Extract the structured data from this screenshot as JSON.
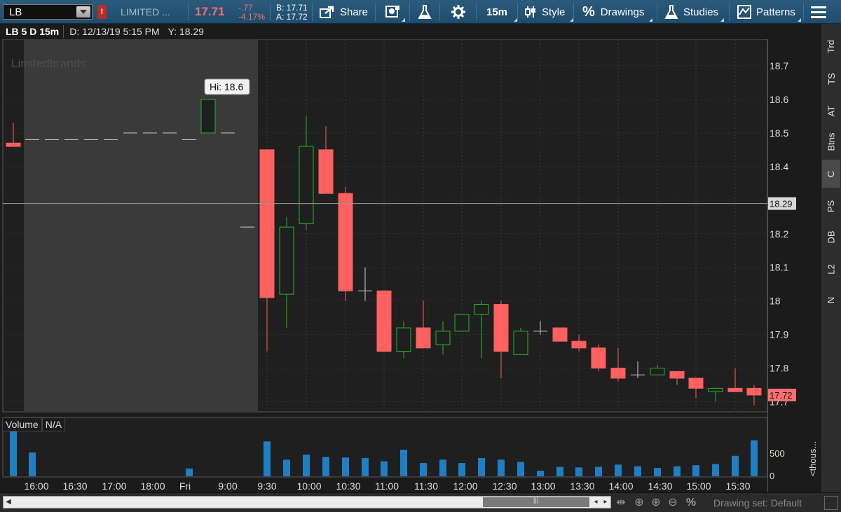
{
  "toolbar": {
    "symbol": "LB",
    "alert_badge": "!",
    "company": "LIMITED ...",
    "last_price": "17.71",
    "net_change": "-.77",
    "pct_change": "-4.17%",
    "bid": "B: 17.71",
    "ask": "A: 17.72",
    "share_label": "Share",
    "aggregation": "15m",
    "style_label": "Style",
    "drawings_label": "Drawings",
    "studies_label": "Studies",
    "patterns_label": "Patterns",
    "accent_down": "#ff6f6f",
    "bg": "#285878"
  },
  "chart_header": {
    "symbol_period": "LB 5 D 15m",
    "date": "D: 12/13/19 5:15 PM",
    "y_readout": "Y: 18.29"
  },
  "chart": {
    "watermark": "Limitedbrands",
    "hi_label": "Hi: 18.6",
    "crosshair_price": "18.29",
    "last_price_tag": "17.72",
    "y_ticks": [
      "18.7",
      "18.6",
      "18.5",
      "18.4",
      "18.3",
      "18.2",
      "18.1",
      "18",
      "17.9",
      "17.8",
      "17.7"
    ],
    "x_ticks": [
      "16:00",
      "16:30",
      "17:00",
      "18:00",
      "Fri",
      "9:00",
      "9:30",
      "10:00",
      "10:30",
      "11:00",
      "11:30",
      "12:00",
      "12:30",
      "13:00",
      "13:30",
      "14:00",
      "14:30",
      "15:00",
      "15:30"
    ]
  },
  "volume": {
    "label": "Volume",
    "value": "N/A",
    "tick_500": "500",
    "tick_0": "0",
    "unit_label": "<thous..."
  },
  "side_tabs": [
    "Trd",
    "TS",
    "AT",
    "Btns",
    "C",
    "PS",
    "DB",
    "L2",
    "N"
  ],
  "bottom": {
    "drawing_set": "Drawing set: Default"
  },
  "chart_data": {
    "type": "candlestick",
    "symbol": "LB",
    "interval": "15m",
    "ylim": [
      17.67,
      18.76
    ],
    "candles": [
      {
        "t": "15:45",
        "o": 18.47,
        "h": 18.53,
        "l": 18.46,
        "c": 18.46
      },
      {
        "t": "16:00",
        "o": 18.48,
        "h": 18.48,
        "l": 18.48,
        "c": 18.48
      },
      {
        "t": "16:15",
        "o": 18.48,
        "h": 18.48,
        "l": 18.48,
        "c": 18.48
      },
      {
        "t": "16:30",
        "o": 18.48,
        "h": 18.48,
        "l": 18.48,
        "c": 18.48
      },
      {
        "t": "16:45",
        "o": 18.48,
        "h": 18.48,
        "l": 18.48,
        "c": 18.48
      },
      {
        "t": "17:00",
        "o": 18.48,
        "h": 18.48,
        "l": 18.48,
        "c": 18.48
      },
      {
        "t": "17:30",
        "o": 18.5,
        "h": 18.5,
        "l": 18.5,
        "c": 18.5
      },
      {
        "t": "17:45",
        "o": 18.5,
        "h": 18.5,
        "l": 18.5,
        "c": 18.5
      },
      {
        "t": "18:00",
        "o": 18.5,
        "h": 18.5,
        "l": 18.5,
        "c": 18.5
      },
      {
        "t": "18:15",
        "o": 18.48,
        "h": 18.48,
        "l": 18.48,
        "c": 18.48
      },
      {
        "t": "8:30",
        "o": 18.5,
        "h": 18.6,
        "l": 18.5,
        "c": 18.6
      },
      {
        "t": "8:45",
        "o": 18.5,
        "h": 18.5,
        "l": 18.5,
        "c": 18.5
      },
      {
        "t": "9:15",
        "o": 18.22,
        "h": 18.22,
        "l": 18.22,
        "c": 18.22
      },
      {
        "t": "9:30",
        "o": 18.45,
        "h": 18.45,
        "l": 17.85,
        "c": 18.01
      },
      {
        "t": "9:45",
        "o": 18.02,
        "h": 18.25,
        "l": 17.92,
        "c": 18.22
      },
      {
        "t": "10:00",
        "o": 18.23,
        "h": 18.55,
        "l": 18.21,
        "c": 18.46
      },
      {
        "t": "10:15",
        "o": 18.45,
        "h": 18.52,
        "l": 18.32,
        "c": 18.32
      },
      {
        "t": "10:30",
        "o": 18.32,
        "h": 18.34,
        "l": 18.0,
        "c": 18.03
      },
      {
        "t": "10:45",
        "o": 18.03,
        "h": 18.1,
        "l": 18.0,
        "c": 18.03
      },
      {
        "t": "11:00",
        "o": 18.03,
        "h": 18.03,
        "l": 17.85,
        "c": 17.85
      },
      {
        "t": "11:15",
        "o": 17.85,
        "h": 17.94,
        "l": 17.83,
        "c": 17.92
      },
      {
        "t": "11:30",
        "o": 17.92,
        "h": 18.0,
        "l": 17.86,
        "c": 17.86
      },
      {
        "t": "11:45",
        "o": 17.87,
        "h": 17.94,
        "l": 17.84,
        "c": 17.91
      },
      {
        "t": "12:00",
        "o": 17.91,
        "h": 17.96,
        "l": 17.91,
        "c": 17.96
      },
      {
        "t": "12:15",
        "o": 17.96,
        "h": 18.0,
        "l": 17.83,
        "c": 17.99
      },
      {
        "t": "12:30",
        "o": 17.99,
        "h": 18.0,
        "l": 17.77,
        "c": 17.85
      },
      {
        "t": "12:45",
        "o": 17.84,
        "h": 17.92,
        "l": 17.84,
        "c": 17.91
      },
      {
        "t": "13:00",
        "o": 17.91,
        "h": 17.94,
        "l": 17.9,
        "c": 17.91
      },
      {
        "t": "13:15",
        "o": 17.92,
        "h": 17.92,
        "l": 17.88,
        "c": 17.88
      },
      {
        "t": "13:30",
        "o": 17.88,
        "h": 17.9,
        "l": 17.85,
        "c": 17.86
      },
      {
        "t": "13:45",
        "o": 17.86,
        "h": 17.87,
        "l": 17.79,
        "c": 17.8
      },
      {
        "t": "14:00",
        "o": 17.8,
        "h": 17.86,
        "l": 17.76,
        "c": 17.77
      },
      {
        "t": "14:15",
        "o": 17.78,
        "h": 17.82,
        "l": 17.77,
        "c": 17.78
      },
      {
        "t": "14:30",
        "o": 17.78,
        "h": 17.81,
        "l": 17.78,
        "c": 17.8
      },
      {
        "t": "14:45",
        "o": 17.79,
        "h": 17.79,
        "l": 17.75,
        "c": 17.77
      },
      {
        "t": "15:00",
        "o": 17.77,
        "h": 17.77,
        "l": 17.71,
        "c": 17.74
      },
      {
        "t": "15:15",
        "o": 17.73,
        "h": 17.74,
        "l": 17.7,
        "c": 17.74
      },
      {
        "t": "15:30",
        "o": 17.74,
        "h": 17.8,
        "l": 17.73,
        "c": 17.73
      },
      {
        "t": "15:45",
        "o": 17.74,
        "h": 17.75,
        "l": 17.69,
        "c": 17.72
      }
    ],
    "volume_thousands": [
      990,
      430,
      0,
      0,
      0,
      0,
      0,
      0,
      0,
      140,
      0,
      0,
      0,
      630,
      300,
      390,
      350,
      340,
      330,
      270,
      480,
      240,
      300,
      240,
      330,
      300,
      260,
      100,
      170,
      160,
      170,
      210,
      180,
      150,
      180,
      200,
      220,
      370,
      650
    ]
  }
}
